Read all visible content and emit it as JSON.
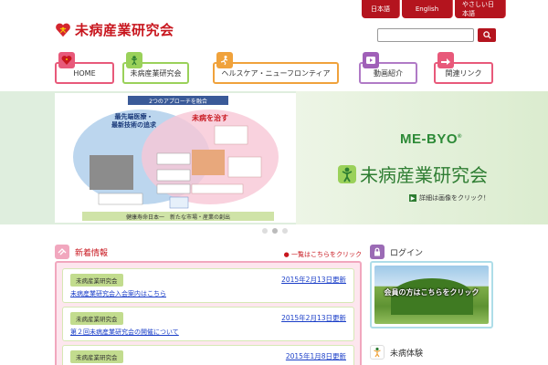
{
  "lang": {
    "japanese": "日本語",
    "english": "English",
    "simple": "やさしい日本語"
  },
  "logo": {
    "text": "未病産業研究会"
  },
  "search": {
    "placeholder": ""
  },
  "nav": {
    "home": "HOME",
    "institute": "未病産業研究会",
    "health": "ヘルスケア・ニューフロンティア",
    "video": "動画紹介",
    "links": "関連リンク"
  },
  "hero": {
    "slide_header": "2つのアプローチを融合",
    "slide_footer": "健康寿命日本一　新たな市場・産業の創出",
    "left_label_1": "最先端医療・",
    "left_label_2": "最新技術の追求",
    "right_label": "未病を治す",
    "mebyo": "ME-BYO",
    "registered": "®",
    "title": "未病産業研究会",
    "click_note": "詳細は画像をクリック！"
  },
  "news": {
    "title": "新着情報",
    "list_link": "一覧はこちらをクリック",
    "items": [
      {
        "tag": "未病産業研究会",
        "date": "2015年2月13日更新",
        "text": "未病産業研究会入会案内はこちら"
      },
      {
        "tag": "未病産業研究会",
        "date": "2015年2月13日更新",
        "text": "第２回未病産業研究会の開催について"
      },
      {
        "tag": "未病産業研究会",
        "date": "2015年1月8日更新",
        "text": ""
      }
    ]
  },
  "side": {
    "login": "ログイン",
    "login_banner": "会員の方はこちらをクリック",
    "taiken": "未病体験"
  },
  "colors": {
    "brand_red": "#b4141e",
    "green": "#2e7d32",
    "pink": "#f1a7be"
  }
}
